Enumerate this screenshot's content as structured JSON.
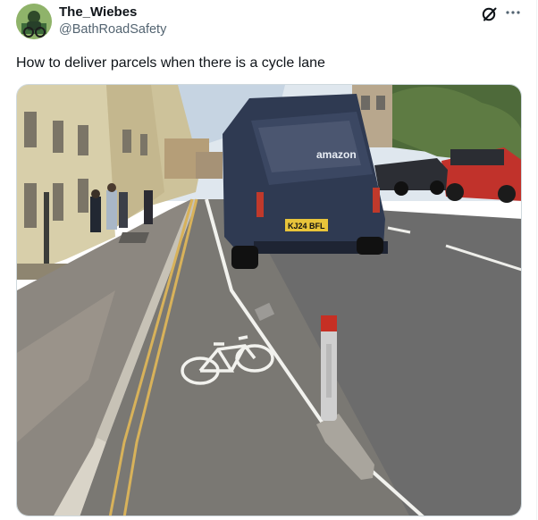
{
  "tweet": {
    "author_name": "The_Wiebes",
    "author_handle": "@BathRoadSafety",
    "text": "How to deliver parcels when there is a cycle lane"
  },
  "icons": {
    "grok": "grok-icon",
    "more": "more-icon"
  },
  "media": {
    "van_brand": "amazon",
    "license_plate": "KJ24 BFL"
  },
  "colors": {
    "text_primary": "#0f1419",
    "text_secondary": "#536471",
    "van": "#2f3a52",
    "lane_marking": "#f2f2ee"
  }
}
